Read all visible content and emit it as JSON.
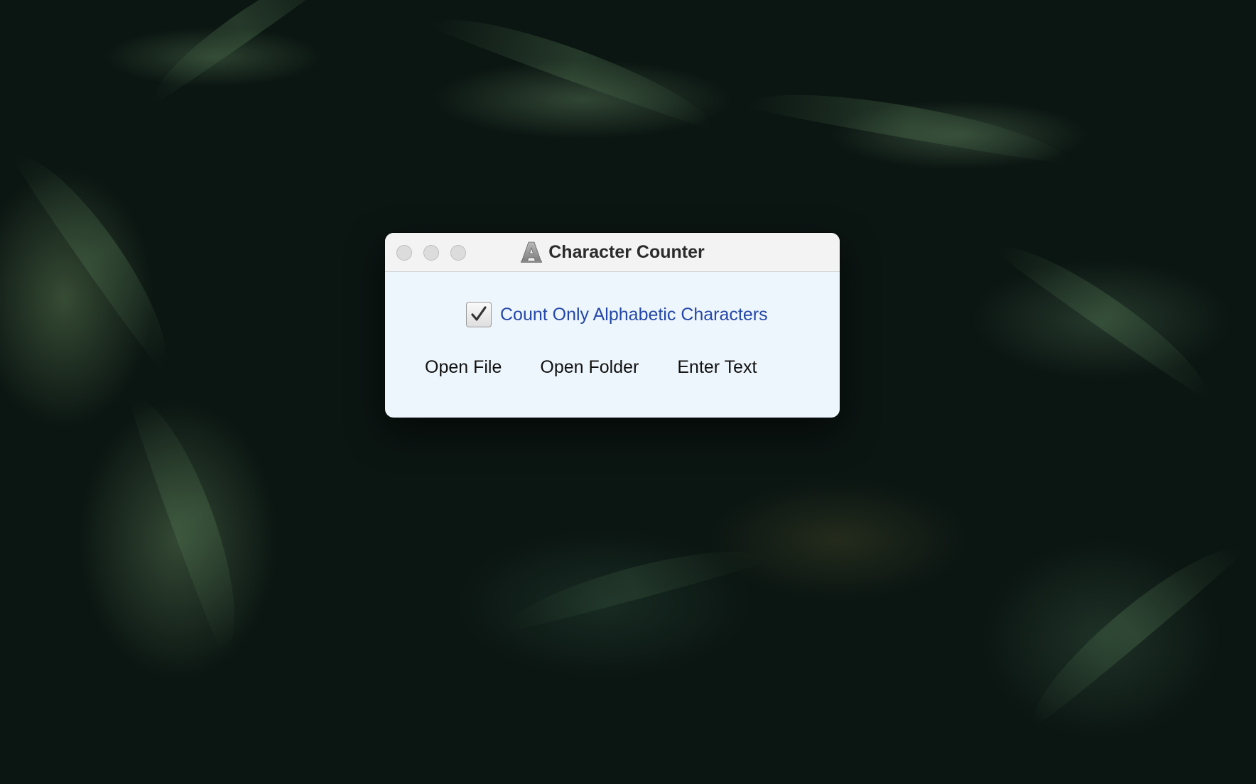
{
  "window": {
    "title": "Character Counter",
    "app_icon": "letter-a-icon"
  },
  "options": {
    "alphabetic_only_label": "Count Only Alphabetic Characters",
    "alphabetic_only_checked": true
  },
  "buttons": {
    "open_file": "Open File",
    "open_folder": "Open Folder",
    "enter_text": "Enter Text"
  },
  "colors": {
    "window_bg": "#eef6fd",
    "checkbox_label": "#2447a8"
  }
}
